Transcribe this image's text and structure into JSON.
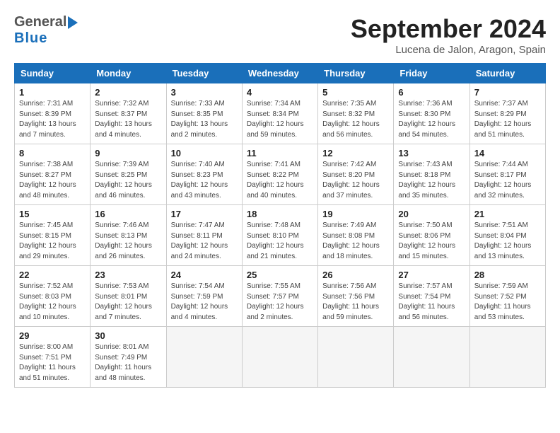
{
  "header": {
    "logo": {
      "line1": "General",
      "line2": "Blue"
    },
    "title": "September 2024",
    "location": "Lucena de Jalon, Aragon, Spain"
  },
  "calendar": {
    "headers": [
      "Sunday",
      "Monday",
      "Tuesday",
      "Wednesday",
      "Thursday",
      "Friday",
      "Saturday"
    ],
    "weeks": [
      [
        {
          "day": null,
          "info": ""
        },
        {
          "day": null,
          "info": ""
        },
        {
          "day": null,
          "info": ""
        },
        {
          "day": null,
          "info": ""
        },
        {
          "day": null,
          "info": ""
        },
        {
          "day": null,
          "info": ""
        },
        {
          "day": null,
          "info": ""
        }
      ],
      [
        {
          "day": 1,
          "sunrise": "Sunrise: 7:31 AM",
          "sunset": "Sunset: 8:39 PM",
          "daylight": "Daylight: 13 hours and 7 minutes."
        },
        {
          "day": 2,
          "sunrise": "Sunrise: 7:32 AM",
          "sunset": "Sunset: 8:37 PM",
          "daylight": "Daylight: 13 hours and 4 minutes."
        },
        {
          "day": 3,
          "sunrise": "Sunrise: 7:33 AM",
          "sunset": "Sunset: 8:35 PM",
          "daylight": "Daylight: 13 hours and 2 minutes."
        },
        {
          "day": 4,
          "sunrise": "Sunrise: 7:34 AM",
          "sunset": "Sunset: 8:34 PM",
          "daylight": "Daylight: 12 hours and 59 minutes."
        },
        {
          "day": 5,
          "sunrise": "Sunrise: 7:35 AM",
          "sunset": "Sunset: 8:32 PM",
          "daylight": "Daylight: 12 hours and 56 minutes."
        },
        {
          "day": 6,
          "sunrise": "Sunrise: 7:36 AM",
          "sunset": "Sunset: 8:30 PM",
          "daylight": "Daylight: 12 hours and 54 minutes."
        },
        {
          "day": 7,
          "sunrise": "Sunrise: 7:37 AM",
          "sunset": "Sunset: 8:29 PM",
          "daylight": "Daylight: 12 hours and 51 minutes."
        }
      ],
      [
        {
          "day": 8,
          "sunrise": "Sunrise: 7:38 AM",
          "sunset": "Sunset: 8:27 PM",
          "daylight": "Daylight: 12 hours and 48 minutes."
        },
        {
          "day": 9,
          "sunrise": "Sunrise: 7:39 AM",
          "sunset": "Sunset: 8:25 PM",
          "daylight": "Daylight: 12 hours and 46 minutes."
        },
        {
          "day": 10,
          "sunrise": "Sunrise: 7:40 AM",
          "sunset": "Sunset: 8:23 PM",
          "daylight": "Daylight: 12 hours and 43 minutes."
        },
        {
          "day": 11,
          "sunrise": "Sunrise: 7:41 AM",
          "sunset": "Sunset: 8:22 PM",
          "daylight": "Daylight: 12 hours and 40 minutes."
        },
        {
          "day": 12,
          "sunrise": "Sunrise: 7:42 AM",
          "sunset": "Sunset: 8:20 PM",
          "daylight": "Daylight: 12 hours and 37 minutes."
        },
        {
          "day": 13,
          "sunrise": "Sunrise: 7:43 AM",
          "sunset": "Sunset: 8:18 PM",
          "daylight": "Daylight: 12 hours and 35 minutes."
        },
        {
          "day": 14,
          "sunrise": "Sunrise: 7:44 AM",
          "sunset": "Sunset: 8:17 PM",
          "daylight": "Daylight: 12 hours and 32 minutes."
        }
      ],
      [
        {
          "day": 15,
          "sunrise": "Sunrise: 7:45 AM",
          "sunset": "Sunset: 8:15 PM",
          "daylight": "Daylight: 12 hours and 29 minutes."
        },
        {
          "day": 16,
          "sunrise": "Sunrise: 7:46 AM",
          "sunset": "Sunset: 8:13 PM",
          "daylight": "Daylight: 12 hours and 26 minutes."
        },
        {
          "day": 17,
          "sunrise": "Sunrise: 7:47 AM",
          "sunset": "Sunset: 8:11 PM",
          "daylight": "Daylight: 12 hours and 24 minutes."
        },
        {
          "day": 18,
          "sunrise": "Sunrise: 7:48 AM",
          "sunset": "Sunset: 8:10 PM",
          "daylight": "Daylight: 12 hours and 21 minutes."
        },
        {
          "day": 19,
          "sunrise": "Sunrise: 7:49 AM",
          "sunset": "Sunset: 8:08 PM",
          "daylight": "Daylight: 12 hours and 18 minutes."
        },
        {
          "day": 20,
          "sunrise": "Sunrise: 7:50 AM",
          "sunset": "Sunset: 8:06 PM",
          "daylight": "Daylight: 12 hours and 15 minutes."
        },
        {
          "day": 21,
          "sunrise": "Sunrise: 7:51 AM",
          "sunset": "Sunset: 8:04 PM",
          "daylight": "Daylight: 12 hours and 13 minutes."
        }
      ],
      [
        {
          "day": 22,
          "sunrise": "Sunrise: 7:52 AM",
          "sunset": "Sunset: 8:03 PM",
          "daylight": "Daylight: 12 hours and 10 minutes."
        },
        {
          "day": 23,
          "sunrise": "Sunrise: 7:53 AM",
          "sunset": "Sunset: 8:01 PM",
          "daylight": "Daylight: 12 hours and 7 minutes."
        },
        {
          "day": 24,
          "sunrise": "Sunrise: 7:54 AM",
          "sunset": "Sunset: 7:59 PM",
          "daylight": "Daylight: 12 hours and 4 minutes."
        },
        {
          "day": 25,
          "sunrise": "Sunrise: 7:55 AM",
          "sunset": "Sunset: 7:57 PM",
          "daylight": "Daylight: 12 hours and 2 minutes."
        },
        {
          "day": 26,
          "sunrise": "Sunrise: 7:56 AM",
          "sunset": "Sunset: 7:56 PM",
          "daylight": "Daylight: 11 hours and 59 minutes."
        },
        {
          "day": 27,
          "sunrise": "Sunrise: 7:57 AM",
          "sunset": "Sunset: 7:54 PM",
          "daylight": "Daylight: 11 hours and 56 minutes."
        },
        {
          "day": 28,
          "sunrise": "Sunrise: 7:59 AM",
          "sunset": "Sunset: 7:52 PM",
          "daylight": "Daylight: 11 hours and 53 minutes."
        }
      ],
      [
        {
          "day": 29,
          "sunrise": "Sunrise: 8:00 AM",
          "sunset": "Sunset: 7:51 PM",
          "daylight": "Daylight: 11 hours and 51 minutes."
        },
        {
          "day": 30,
          "sunrise": "Sunrise: 8:01 AM",
          "sunset": "Sunset: 7:49 PM",
          "daylight": "Daylight: 11 hours and 48 minutes."
        },
        {
          "day": null,
          "info": ""
        },
        {
          "day": null,
          "info": ""
        },
        {
          "day": null,
          "info": ""
        },
        {
          "day": null,
          "info": ""
        },
        {
          "day": null,
          "info": ""
        }
      ]
    ]
  }
}
